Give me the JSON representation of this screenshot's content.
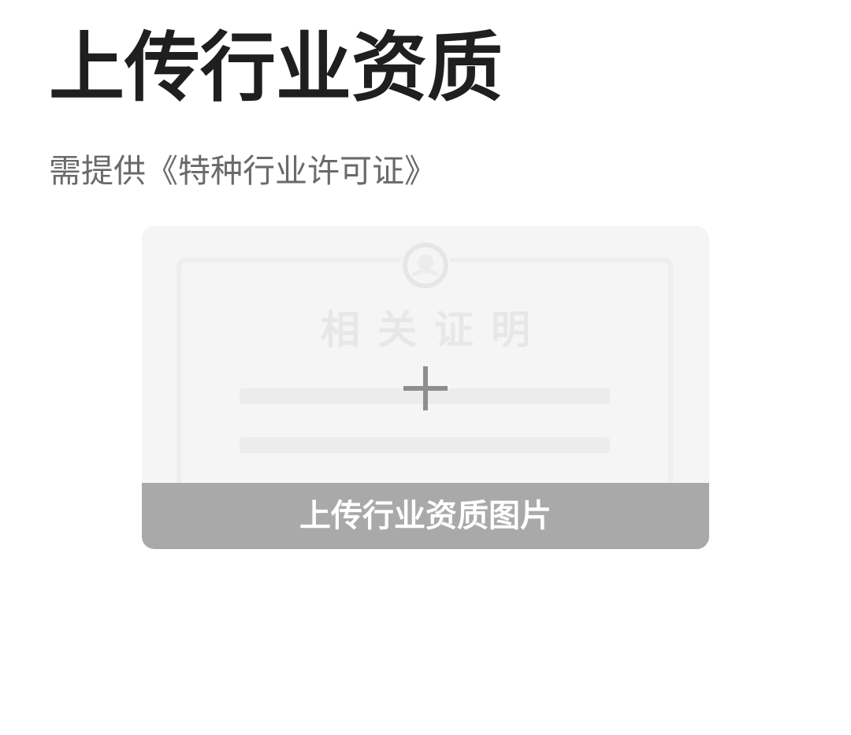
{
  "header": {
    "title": "上传行业资质",
    "subtitle": "需提供《特种行业许可证》"
  },
  "upload": {
    "placeholder_label": "相关证明",
    "caption": "上传行业资质图片",
    "icons": {
      "emblem": "emblem-icon",
      "add": "plus-icon"
    }
  },
  "colors": {
    "title": "#1f1f1f",
    "subtitle": "#6a6a6a",
    "card_background": "#f5f5f5",
    "caption_background": "#a9a9a9",
    "caption_text": "#ffffff",
    "plus": "#8e8e8e"
  }
}
